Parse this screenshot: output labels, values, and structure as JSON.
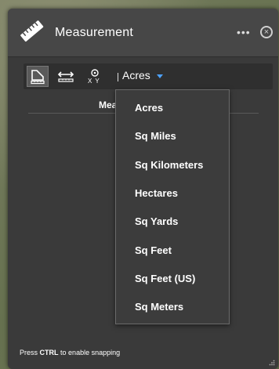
{
  "widget": {
    "title": "Measurement",
    "icons": {
      "ruler": "ruler-icon",
      "more": "more-options-icon",
      "close": "close-icon"
    }
  },
  "toolbar": {
    "tools": [
      {
        "name": "area",
        "icon": "area-measure-icon",
        "active": true
      },
      {
        "name": "distance",
        "icon": "distance-measure-icon",
        "active": false
      },
      {
        "name": "location",
        "icon": "location-xy-icon",
        "label": "X Y",
        "active": false
      }
    ],
    "unit_selected": "Acres"
  },
  "result": {
    "label": "Mea"
  },
  "dropdown": {
    "options": [
      "Acres",
      "Sq Miles",
      "Sq Kilometers",
      "Hectares",
      "Sq Yards",
      "Sq Feet",
      "Sq Feet (US)",
      "Sq Meters"
    ]
  },
  "footer": {
    "prefix": "Press",
    "key": "CTRL",
    "suffix": "to enable snapping"
  },
  "colors": {
    "panel": "#3a3a3a",
    "header": "#474747",
    "caret": "#4da3ff"
  }
}
